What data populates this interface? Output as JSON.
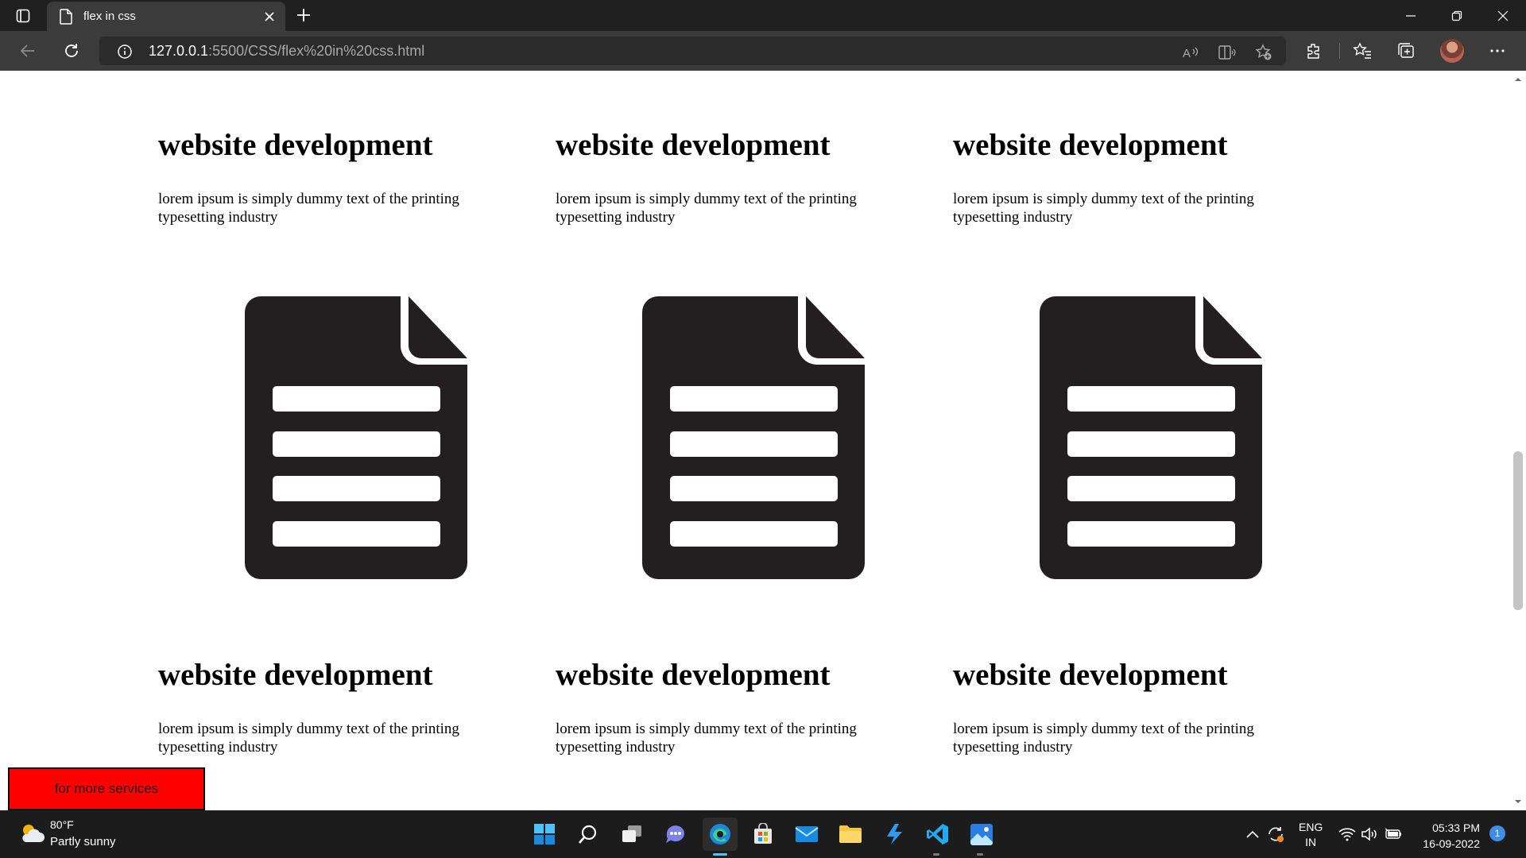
{
  "browser": {
    "tab_title": "flex in css",
    "url_host": "127.0.0.1",
    "url_path": ":5500/CSS/flex%20in%20css.html"
  },
  "page": {
    "top_cards": [
      {
        "title": "website development",
        "text": "lorem ipsum is simply dummy text of the printing typesetting industry"
      },
      {
        "title": "website development",
        "text": "lorem ipsum is simply dummy text of the printing typesetting industry"
      },
      {
        "title": "website development",
        "text": "lorem ipsum is simply dummy text of the printing typesetting industry"
      }
    ],
    "bottom_cards": [
      {
        "title": "website development",
        "text": "lorem ipsum is simply dummy text of the printing typesetting industry"
      },
      {
        "title": "website development",
        "text": "lorem ipsum is simply dummy text of the printing typesetting industry"
      },
      {
        "title": "website development",
        "text": "lorem ipsum is simply dummy text of the printing typesetting industry"
      }
    ],
    "icons": [
      "document-icon",
      "document-icon",
      "document-icon"
    ],
    "services_button": "for more services"
  },
  "taskbar": {
    "weather_temp": "80°F",
    "weather_desc": "Partly sunny",
    "lang_top": "ENG",
    "lang_bottom": "IN",
    "time": "05:33 PM",
    "date": "16-09-2022",
    "notification_count": "1",
    "apps": [
      "start-icon",
      "search-icon",
      "task-view-icon",
      "chat-icon",
      "edge-icon",
      "store-icon",
      "mail-icon",
      "file-explorer-icon",
      "azure-icon",
      "vscode-icon",
      "photos-icon"
    ]
  },
  "colors": {
    "services_button_bg": "#ff0000",
    "document_icon": "#231f20",
    "chrome_dark": "#202020",
    "address_bar": "#3b3b3b"
  }
}
